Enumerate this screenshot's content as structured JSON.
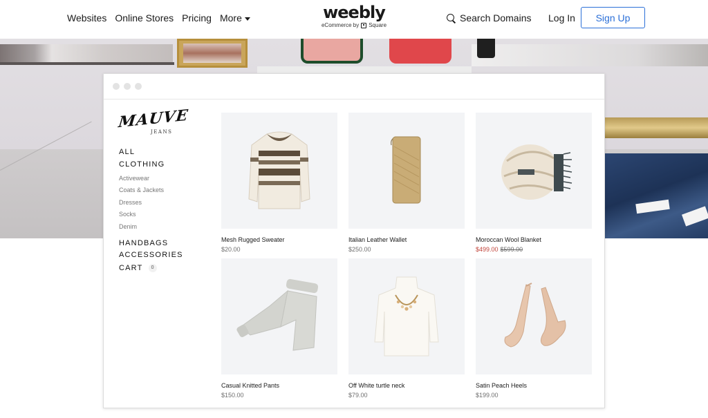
{
  "nav": {
    "links": [
      "Websites",
      "Online Stores",
      "Pricing",
      "More"
    ],
    "logo": "weebly",
    "logo_sub": "eCommerce by",
    "logo_sub_brand": "Square",
    "search_label": "Search Domains",
    "login_label": "Log In",
    "signup_label": "Sign Up"
  },
  "store": {
    "brand": "MAUVE",
    "brand_sub": "JEANS",
    "menu": {
      "all": "ALL",
      "clothing": "CLOTHING",
      "sub_items": [
        "Activewear",
        "Coats & Jackets",
        "Dresses",
        "Socks",
        "Denim"
      ],
      "handbags": "HANDBAGS",
      "accessories": "ACCESSORIES",
      "cart": "CART",
      "cart_count": "0"
    },
    "products": [
      {
        "name": "Mesh Rugged Sweater",
        "price": "$20.00"
      },
      {
        "name": "Italian Leather Wallet",
        "price": "$250.00"
      },
      {
        "name": "Moroccan Wool Blanket",
        "price": "$499.00",
        "old_price": "$599.00"
      },
      {
        "name": "Casual Knitted Pants",
        "price": "$150.00"
      },
      {
        "name": "Off White turtle neck",
        "price": "$79.00"
      },
      {
        "name": "Satin Peach Heels",
        "price": "$199.00"
      }
    ]
  },
  "colors": {
    "accent": "#2a6fd8",
    "sale": "#c1443a",
    "product_bg": "#f3f4f6"
  }
}
